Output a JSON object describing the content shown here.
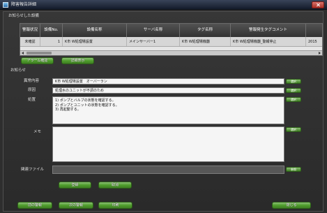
{
  "window": {
    "title": "障害報告詳細"
  },
  "colors": {
    "title_bar": "#1e2a42",
    "close_button": "#c8372d",
    "window_bg": "#2e2e2e",
    "table_header_bg": "#3f3f3f",
    "table_row_bg": "#d6d6d6",
    "button_green": "#4f9e2c",
    "field_bg": "#f5f5f5",
    "label_text": "#e0e0e0"
  },
  "icons": {
    "app": "app-icon",
    "close": "close-icon",
    "scroll_left": "arrow-left-icon",
    "scroll_right": "arrow-right-icon"
  },
  "alarms": {
    "label": "お知らせした設備",
    "columns": [
      "警報状況",
      "設備No.",
      "設備名称",
      "サーバ名称",
      "タグ名称",
      "警報発生タグコメント",
      ""
    ],
    "rows": [
      [
        "未確認",
        "1",
        "K市 W処理場設置",
        "メインサーバー1",
        "K市 W処理場機器",
        "K市 W処理場機器_警報停止",
        "2015"
      ]
    ],
    "buttons": {
      "acknowledge": "アラーム確認",
      "detail": "詳細表示"
    }
  },
  "notice": {
    "label": "お知らせ",
    "content": {
      "label": "異常内容",
      "value": "K市 W処理場設置　オーバーラン",
      "button": "選択"
    },
    "cause": {
      "label": "原因",
      "value": "処理水のユニットが不調のため",
      "button": "選択"
    },
    "action": {
      "label": "処置",
      "value": "1) ポンプとバルブの状態を確認する。\n2) ポンプとユニットの状態を確認する。\n3) 再起動する。",
      "button": "選択"
    },
    "memo": {
      "label": "メモ",
      "value": "",
      "button": "選択"
    },
    "file": {
      "label": "関連ファイル",
      "value": "",
      "button": "参照"
    }
  },
  "form_buttons": {
    "register": "登録",
    "cancel": "取消"
  },
  "footer": {
    "prev": "前の警報",
    "next": "次の警報",
    "print": "印刷",
    "close": "閉じる"
  }
}
